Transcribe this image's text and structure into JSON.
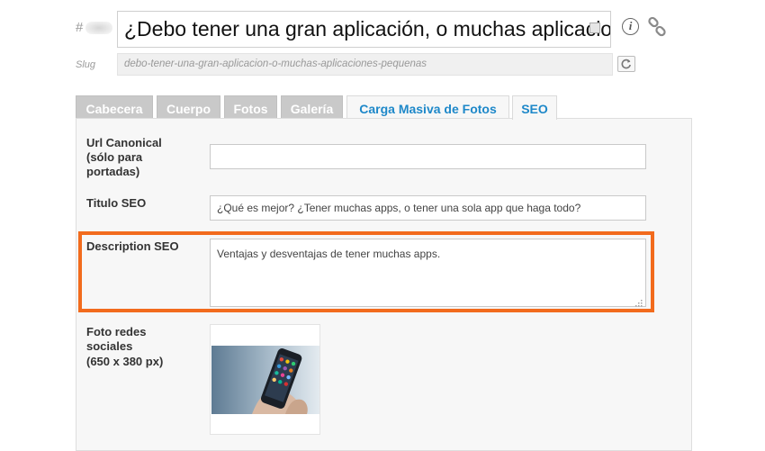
{
  "header": {
    "hash": "#",
    "title_value": "¿Debo tener una gran aplicación, o muchas aplicaciones pequeñas?",
    "info_icon_glyph": "i",
    "slug_label": "Slug",
    "slug_value": "debo-tener-una-gran-aplicacion-o-muchas-aplicaciones-pequenas"
  },
  "tabs": [
    {
      "label": "Cabecera"
    },
    {
      "label": "Cuerpo"
    },
    {
      "label": "Fotos"
    },
    {
      "label": "Galería"
    },
    {
      "label": "Carga Masiva de Fotos"
    },
    {
      "label": "SEO"
    }
  ],
  "seo": {
    "canonical_label_1": "Url Canonical",
    "canonical_label_2": "(sólo para",
    "canonical_label_3": "portadas)",
    "canonical_value": "",
    "title_label": "Titulo SEO",
    "title_value": "¿Qué es mejor? ¿Tener muchas apps, o tener una sola app que haga todo?",
    "description_label": "Description SEO",
    "description_value": "Ventajas y desventajas de tener muchas apps.",
    "photo_label_1": "Foto redes",
    "photo_label_2": "sociales",
    "photo_label_3": "(650 x 380 px)"
  },
  "colors": {
    "accent_blue": "#1e88c9",
    "highlight_orange": "#f26b1d",
    "tab_inactive": "#c9c9c9"
  },
  "icons": [
    "info-icon",
    "link-icon",
    "reset-icon",
    "resize-grip-icon"
  ]
}
